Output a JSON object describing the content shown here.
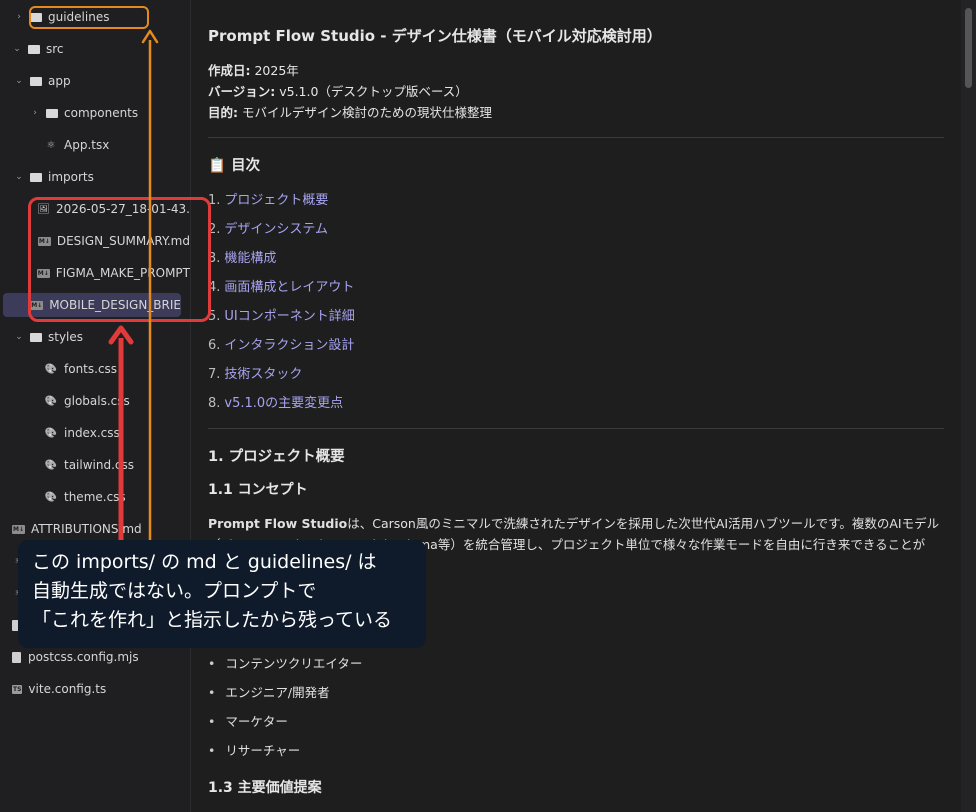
{
  "sidebar": {
    "items": [
      {
        "label": "guidelines",
        "kind": "folder",
        "indent": 1,
        "chevron": "›"
      },
      {
        "label": "src",
        "kind": "folder",
        "indent": 0,
        "chevron": "⌄"
      },
      {
        "label": "app",
        "kind": "folder",
        "indent": 1,
        "chevron": "⌄"
      },
      {
        "label": "components",
        "kind": "folder",
        "indent": 2,
        "chevron": "›"
      },
      {
        "label": "App.tsx",
        "kind": "react",
        "indent": 2
      },
      {
        "label": "imports",
        "kind": "folder",
        "indent": 1,
        "chevron": "⌄"
      },
      {
        "label": "2026-05-27_18-01-43.",
        "kind": "image",
        "indent": 2
      },
      {
        "label": "DESIGN_SUMMARY.md",
        "kind": "md",
        "indent": 2
      },
      {
        "label": "FIGMA_MAKE_PROMPT",
        "kind": "md",
        "indent": 2
      },
      {
        "label": "MOBILE_DESIGN_BRIE",
        "kind": "md",
        "indent": 2,
        "selected": true
      },
      {
        "label": "styles",
        "kind": "folder",
        "indent": 1,
        "chevron": "⌄"
      },
      {
        "label": "fonts.css",
        "kind": "css",
        "indent": 2
      },
      {
        "label": "globals.css",
        "kind": "css",
        "indent": 2
      },
      {
        "label": "index.css",
        "kind": "css",
        "indent": 2
      },
      {
        "label": "tailwind.css",
        "kind": "css",
        "indent": 2
      },
      {
        "label": "theme.css",
        "kind": "css",
        "indent": 2
      },
      {
        "label": "ATTRIBUTIONS.md",
        "kind": "md",
        "indent": 0
      },
      {
        "label": "",
        "kind": "react",
        "indent": 0
      },
      {
        "label": "",
        "kind": "react",
        "indent": 0
      },
      {
        "label": "",
        "kind": "file",
        "indent": 0
      },
      {
        "label": "postcss.config.mjs",
        "kind": "file",
        "indent": 0
      },
      {
        "label": "vite.config.ts",
        "kind": "ts",
        "indent": 0
      }
    ]
  },
  "doc": {
    "title": "Prompt Flow Studio - デザイン仕様書（モバイル対応検討用）",
    "created_label": "作成日:",
    "created_value": " 2025年",
    "version_label": "バージョン:",
    "version_value": " v5.1.0（デスクトップ版ベース）",
    "purpose_label": "目的:",
    "purpose_value": " モバイルデザイン検討のための現状仕様整理",
    "toc_title": "📋 目次",
    "toc": [
      {
        "num": "1.",
        "label": "プロジェクト概要"
      },
      {
        "num": "2.",
        "label": "デザインシステム"
      },
      {
        "num": "3.",
        "label": "機能構成"
      },
      {
        "num": "4.",
        "label": "画面構成とレイアウト"
      },
      {
        "num": "5.",
        "label": "UIコンポーネント詳細"
      },
      {
        "num": "6.",
        "label": "インタラクション設計"
      },
      {
        "num": "7.",
        "label": "技術スタック"
      },
      {
        "num": "8.",
        "label": "v5.1.0の主要変更点"
      }
    ],
    "section1_title": "1. プロジェクト概要",
    "section11_title": "1.1 コンセプト",
    "concept_bold": "Prompt Flow Studio",
    "concept_line1": "は、Carson風のミニマルで洗練されたデザインを採用した次世代AI活用ハブツールです。複数のAIモデル",
    "concept_line2": "（ChatGPT、Claude、Gemini、Llama等）を統合管理し、プロジェクト単位で様々な作業モードを自由に行き来できることが",
    "bullets": [
      "コンテンツクリエイター",
      "エンジニア/開発者",
      "マーケター",
      "リサーチャー"
    ],
    "section13_title": "1.3 主要価値提案"
  },
  "annotation": {
    "line1": "この imports/ の md と guidelines/ は",
    "line2": "自動生成ではない。プロンプトで",
    "line3": "「これを作れ」と指示したから残っている",
    "colors": {
      "orange": "#e58a1f",
      "red": "#e03a3a"
    }
  }
}
